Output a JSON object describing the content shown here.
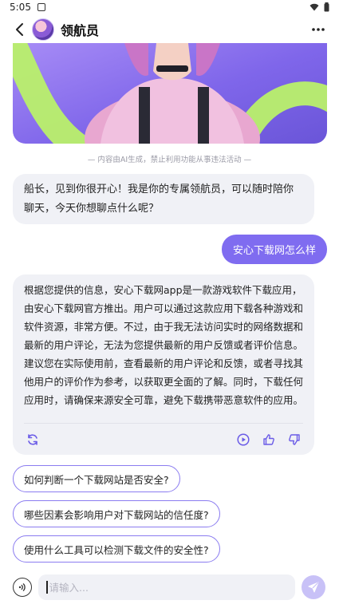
{
  "status_bar": {
    "time": "5:05",
    "icons": [
      "wifi-icon",
      "battery-icon"
    ]
  },
  "header": {
    "title": "领航员",
    "back_icon": "chevron-left-icon",
    "more_icon": "more-icon"
  },
  "hero": {
    "description_icon": "character-image"
  },
  "disclaimer": "— 内容由AI生成，禁止利用功能从事违法活动 —",
  "messages": {
    "greeting": "船长，见到你很开心！我是你的专属领航员，可以随时陪你聊天，今天你想聊点什么呢？",
    "user_query": "安心下载网怎么样",
    "answer": "根据您提供的信息，安心下载网app是一款游戏软件下载应用，由安心下载网官方推出。用户可以通过这款应用下载各种游戏和软件资源，非常方便。不过，由于我无法访问实时的网络数据和最新的用户评论，无法为您提供最新的用户反馈或者评价信息。建议您在实际使用前，查看最新的用户评论和反馈，或者寻找其他用户的评价作为参考，以获取更全面的了解。同时，下载任何应用时，请确保来源安全可靠，避免下载携带恶意软件的应用。"
  },
  "answer_actions": [
    "refresh-icon",
    "play-icon",
    "thumbs-up-icon",
    "thumbs-down-icon"
  ],
  "suggestions": [
    "如何判断一个下载网站是否安全?",
    "哪些因素会影响用户对下载网站的信任度?",
    "使用什么工具可以检测下载文件的安全性?"
  ],
  "input": {
    "placeholder": "请输入..."
  },
  "colors": {
    "accent": "#7f6cf0",
    "bubble": "#f0f1f6",
    "send_disabled": "#c8c1f7"
  }
}
